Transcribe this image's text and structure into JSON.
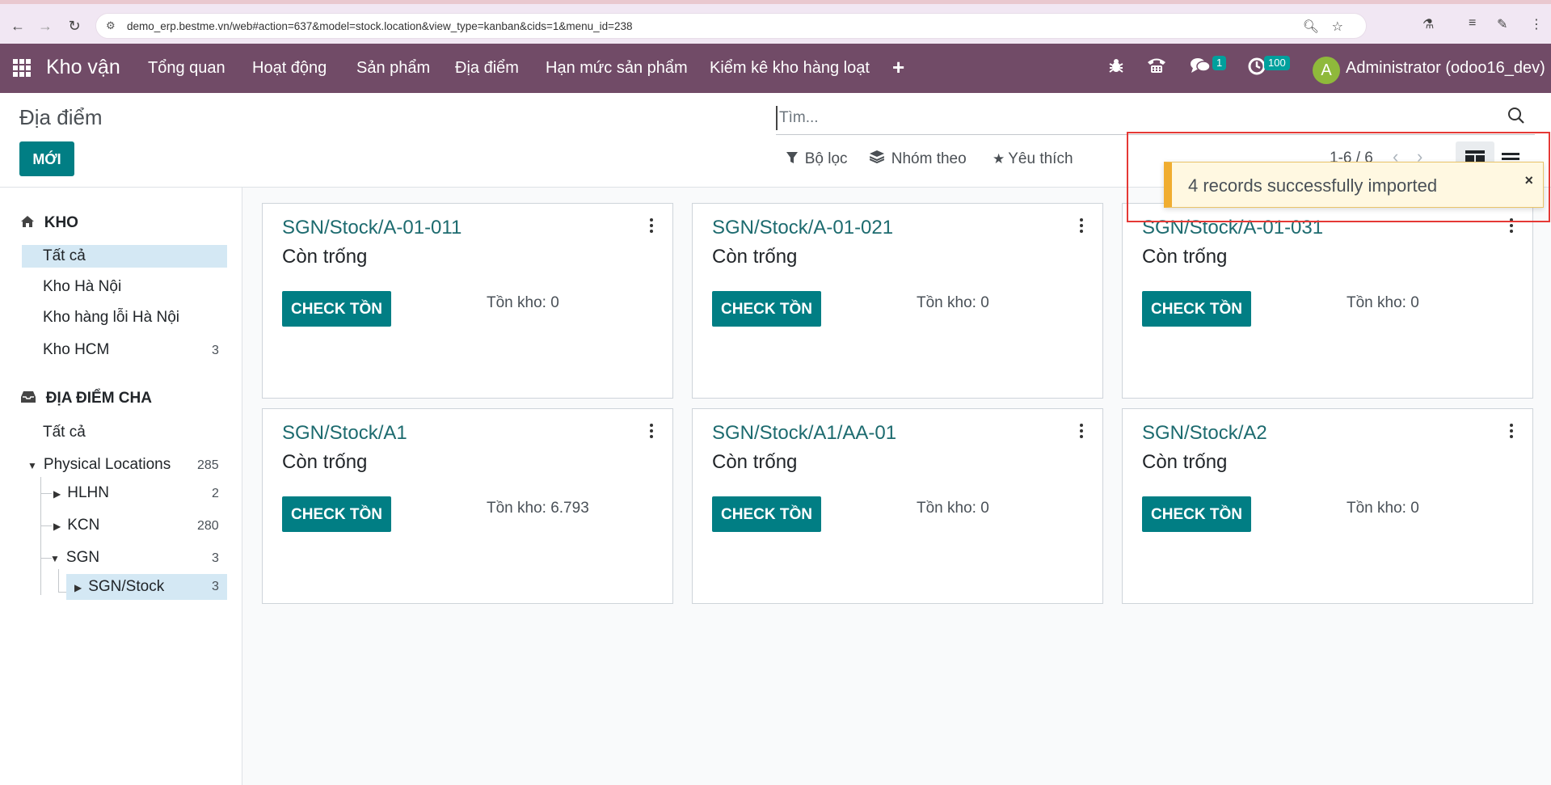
{
  "browser": {
    "url": "demo_erp.bestme.vn/web#action=637&model=stock.location&view_type=kanban&cids=1&menu_id=238"
  },
  "navbar": {
    "app_title": "Kho vận",
    "menu": [
      "Tổng quan",
      "Hoạt động",
      "Sản phẩm",
      "Địa điểm",
      "Hạn mức sản phẩm",
      "Kiểm kê kho hàng loạt"
    ],
    "messages_badge": "1",
    "activities_badge": "100",
    "avatar_letter": "A",
    "user": "Administrator (odoo16_dev)"
  },
  "control": {
    "breadcrumb": "Địa điểm",
    "new_label": "MỚI",
    "search_placeholder": "Tìm...",
    "filters": "Bộ lọc",
    "group_by": "Nhóm theo",
    "favorites": "Yêu thích",
    "pager": "1-6 / 6"
  },
  "toast": {
    "message": "4 records successfully imported",
    "close": "×"
  },
  "sidebar": {
    "section1_title": "KHO",
    "section1_items": [
      {
        "label": "Tất cả",
        "count": ""
      },
      {
        "label": "Kho Hà Nội",
        "count": ""
      },
      {
        "label": "Kho hàng lỗi Hà Nội",
        "count": ""
      },
      {
        "label": "Kho HCM",
        "count": "3"
      }
    ],
    "section2_title": "ĐỊA ĐIỂM CHA",
    "section2_all": "Tất cả",
    "tree": [
      {
        "label": "Physical Locations",
        "count": "285"
      },
      {
        "label": "HLHN",
        "count": "2"
      },
      {
        "label": "KCN",
        "count": "280"
      },
      {
        "label": "SGN",
        "count": "3"
      },
      {
        "label": "SGN/Stock",
        "count": "3"
      }
    ]
  },
  "cards": [
    {
      "title": "SGN/Stock/A-01-011",
      "status": "Còn trống",
      "button": "CHECK TỒN",
      "stock": "Tồn kho: 0"
    },
    {
      "title": "SGN/Stock/A-01-021",
      "status": "Còn trống",
      "button": "CHECK TỒN",
      "stock": "Tồn kho: 0"
    },
    {
      "title": "SGN/Stock/A-01-031",
      "status": "Còn trống",
      "button": "CHECK TỒN",
      "stock": "Tồn kho: 0"
    },
    {
      "title": "SGN/Stock/A1",
      "status": "Còn trống",
      "button": "CHECK TỒN",
      "stock": "Tồn kho: 6.793"
    },
    {
      "title": "SGN/Stock/A1/AA-01",
      "status": "Còn trống",
      "button": "CHECK TỒN",
      "stock": "Tồn kho: 0"
    },
    {
      "title": "SGN/Stock/A2",
      "status": "Còn trống",
      "button": "CHECK TỒN",
      "stock": "Tồn kho: 0"
    }
  ]
}
